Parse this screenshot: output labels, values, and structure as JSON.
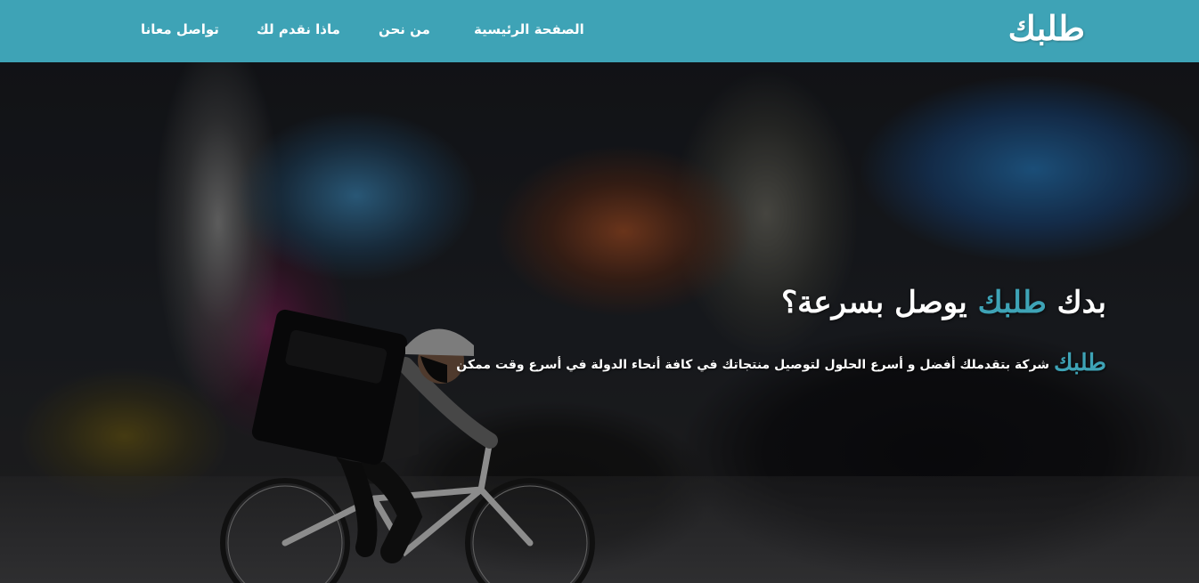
{
  "navbar": {
    "brand": "طلبك",
    "links": [
      {
        "label": "الصفحة الرئيسية"
      },
      {
        "label": "من نحن"
      },
      {
        "label": "ماذا نقدم لك"
      },
      {
        "label": "تواصل معانا"
      }
    ],
    "background_color": "#3ea3b6"
  },
  "hero": {
    "headline_start": "بدك",
    "headline_brand": "طلبك",
    "headline_end": "يوصل بسرعة؟",
    "sub_brand": "طلبك",
    "sub_text": "شركة بتقدملك أفضل و أسرع الحلول لتوصيل منتجاتك في كافة أنحاء الدولة في أسرع وقت ممكن",
    "accent_color": "#3ea3b6",
    "background_image": "delivery-cyclist-city-street"
  }
}
